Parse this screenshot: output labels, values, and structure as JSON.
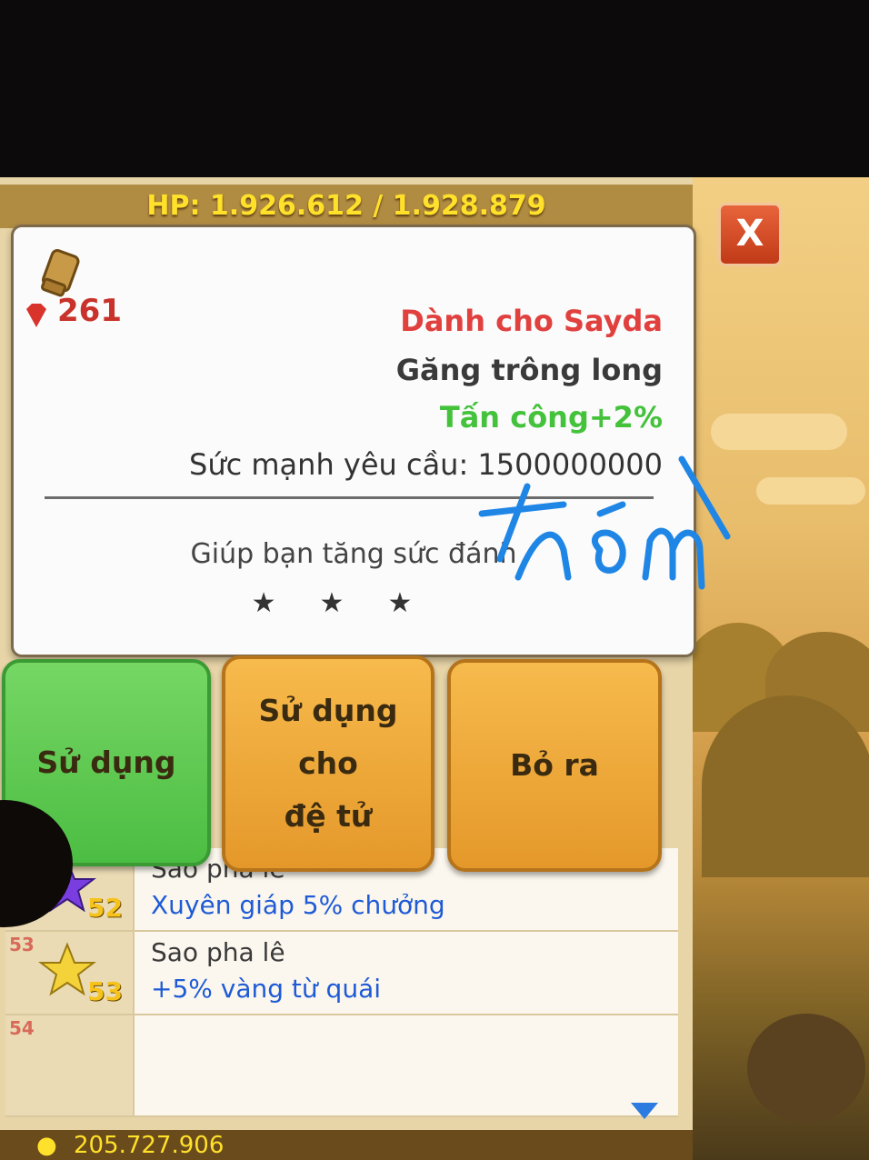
{
  "header": {
    "hp_text": "HP: 1.926.612 / 1.928.879"
  },
  "close_button": {
    "label": "X"
  },
  "popup": {
    "gem_count": "261",
    "for_character": "Dành cho Sayda",
    "item_name": "Găng trông long",
    "item_stat": "Tấn công+2%",
    "power_requirement": "Sức mạnh yêu cầu: 1500000000",
    "hint": "Giúp bạn tăng sức đánh",
    "stars": "★★★"
  },
  "actions": {
    "use_label": "Sử dụng",
    "use_for_disciple_line1": "Sử dụng",
    "use_for_disciple_line2": "cho",
    "use_for_disciple_line3": "đệ tử",
    "drop_label": "Bỏ ra"
  },
  "inventory": {
    "rows": [
      {
        "slot": "52",
        "level": "52",
        "name": "Sao pha lê",
        "desc": "Xuyên giáp 5% chưởng",
        "star_color": "#7a3ee0"
      },
      {
        "slot": "53",
        "level": "53",
        "name": "Sao pha lê",
        "desc": "+5% vàng từ quái",
        "star_color": "#f3d23a"
      },
      {
        "slot": "54",
        "level": "",
        "name": "",
        "desc": "",
        "star_color": ""
      }
    ]
  },
  "footer": {
    "gold": "205.727.906"
  },
  "handwriting": "thôi"
}
